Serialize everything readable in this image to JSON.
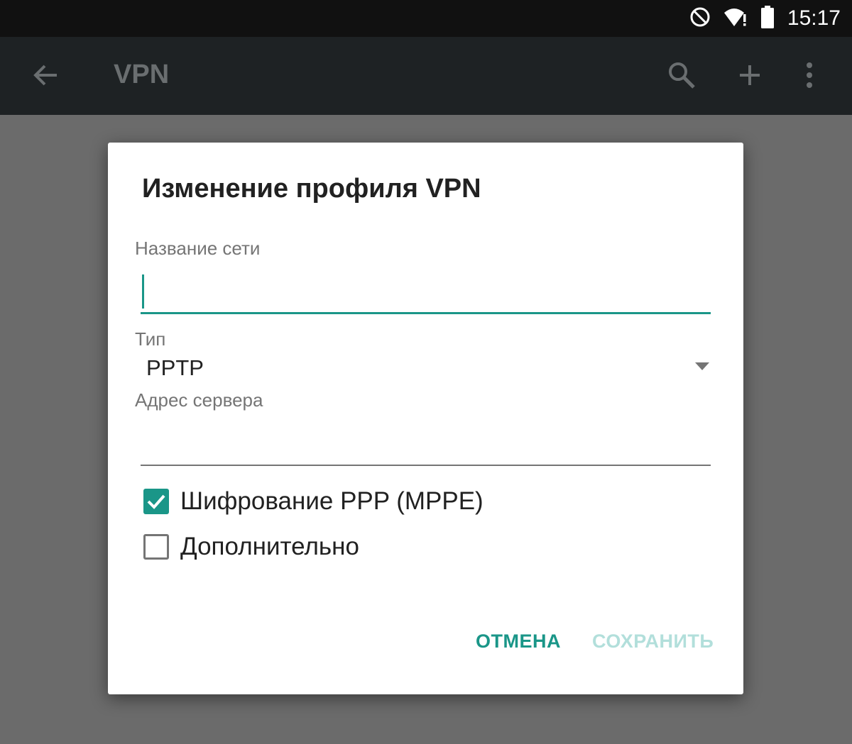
{
  "status_bar": {
    "time": "15:17",
    "icons": [
      "do-not-disturb-icon",
      "wifi-alert-icon",
      "battery-icon"
    ]
  },
  "app_bar": {
    "title": "VPN",
    "icons": [
      "back-arrow-icon",
      "search-icon",
      "add-icon",
      "more-vert-icon"
    ]
  },
  "dialog": {
    "title": "Изменение профиля VPN",
    "network_name": {
      "label": "Название сети",
      "value": ""
    },
    "type": {
      "label": "Тип",
      "selected": "PPTP"
    },
    "server_address": {
      "label": "Адрес сервера",
      "value": ""
    },
    "checkboxes": [
      {
        "label": "Шифрование PPP (MPPE)",
        "checked": true
      },
      {
        "label": "Дополнительно",
        "checked": false
      }
    ],
    "buttons": {
      "cancel": "ОТМЕНА",
      "save": "СОХРАНИТЬ"
    }
  },
  "colors": {
    "accent": "#1a9688",
    "accent_disabled": "#b2dfdb",
    "app_bar": "#1e2224",
    "status_bar": "#111111",
    "scrim": "#6b6b6b"
  }
}
